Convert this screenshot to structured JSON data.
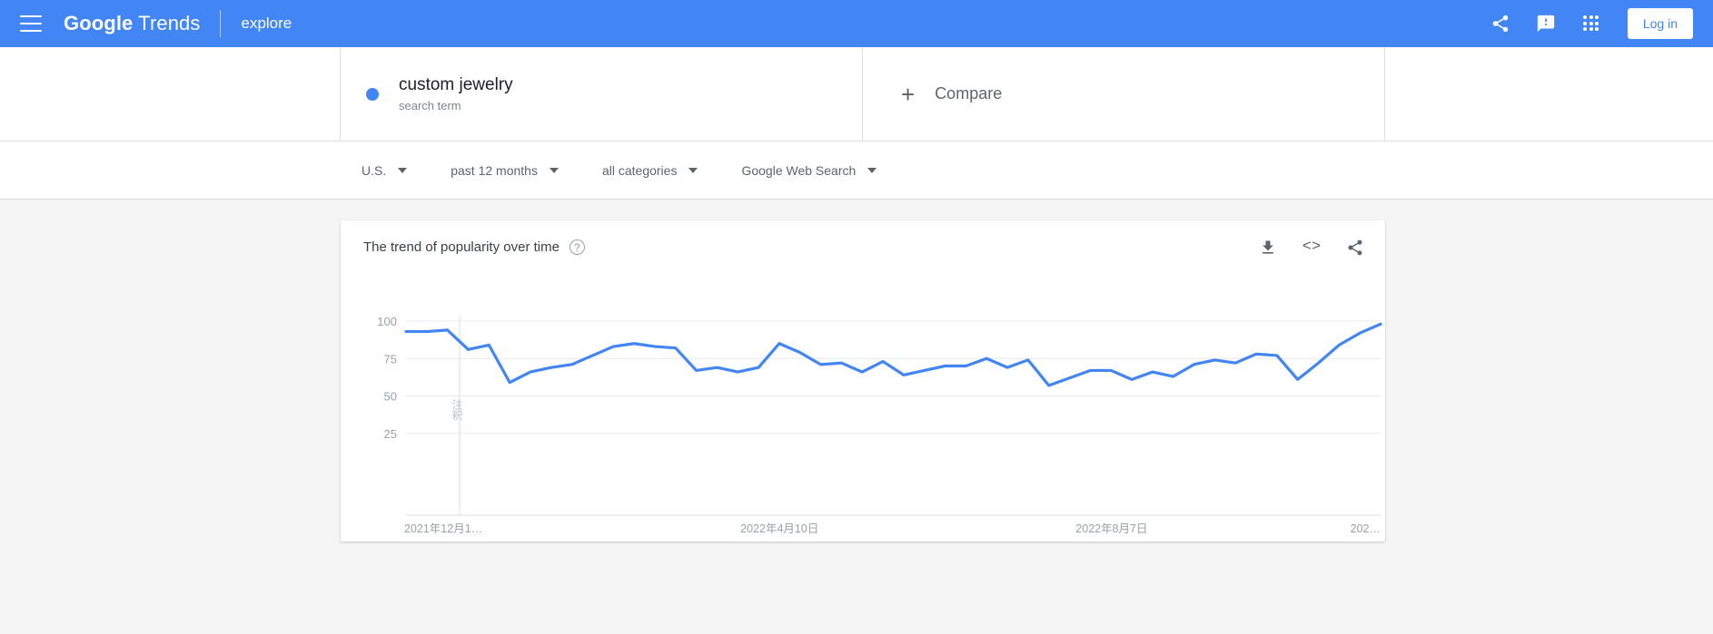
{
  "header": {
    "menu_icon": "hamburger-icon",
    "brand_bold": "Google",
    "brand_light": "Trends",
    "section": "explore",
    "share_icon": "share-icon",
    "feedback_icon": "feedback-icon",
    "apps_icon": "apps-grid-icon",
    "login_label": "Log in",
    "bg_color": "#4285f4"
  },
  "search_term": {
    "name": "custom jewelry",
    "type_label": "search term",
    "dot_color": "#4285f4"
  },
  "compare": {
    "plus": "+",
    "label": "Compare"
  },
  "filters": [
    {
      "label": "U.S."
    },
    {
      "label": "past 12 months"
    },
    {
      "label": "all categories"
    },
    {
      "label": "Google Web Search"
    }
  ],
  "chart_card": {
    "title": "The trend of popularity over time",
    "help_icon": "help-circle-icon",
    "download_icon": "download-icon",
    "embed_icon": "embed-code-icon",
    "embed_glyph": "<>",
    "share_icon": "share-icon"
  },
  "chart_data": {
    "type": "line",
    "title": "The trend of popularity over time",
    "xlabel": "",
    "ylabel": "",
    "ylim": [
      0,
      100
    ],
    "yticks": [
      100,
      75,
      50,
      25
    ],
    "grid": true,
    "legend_position": "none",
    "line_color": "#4285f4",
    "xtick_labels": [
      "2021年12月1…",
      "2022年4月10日",
      "2022年8月7日",
      "202…"
    ],
    "xtick_positions": [
      0,
      0.345,
      0.689,
      1.0
    ],
    "annotation": {
      "text": "注釈",
      "orientation": "vertical",
      "x_position": 0.055
    },
    "series": [
      {
        "name": "custom jewelry",
        "values": [
          93,
          93,
          94,
          81,
          84,
          59,
          66,
          69,
          71,
          77,
          83,
          85,
          83,
          82,
          67,
          69,
          66,
          69,
          85,
          79,
          71,
          72,
          66,
          73,
          64,
          67,
          70,
          70,
          75,
          69,
          74,
          57,
          62,
          67,
          67,
          61,
          66,
          63,
          71,
          74,
          72,
          78,
          77,
          61,
          72,
          84,
          92,
          98
        ]
      }
    ]
  }
}
